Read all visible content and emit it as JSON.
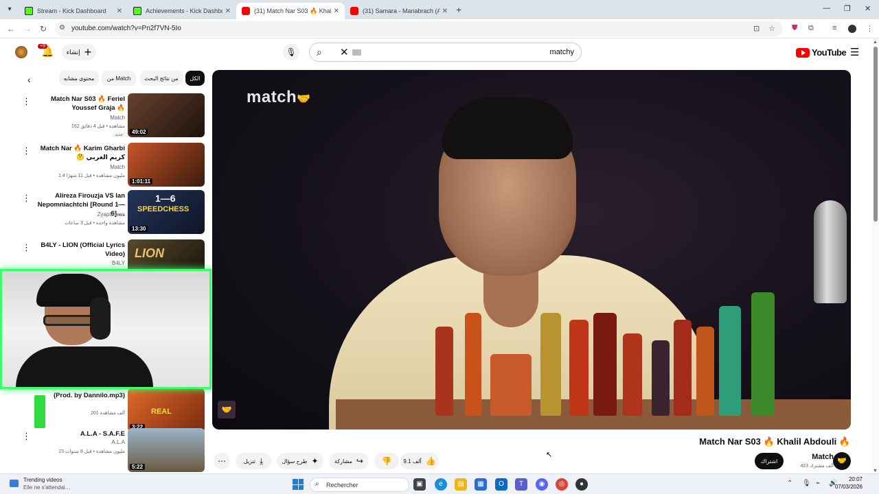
{
  "browser": {
    "tabs": [
      {
        "title": "Stream - Kick Dashboard",
        "type": "kick"
      },
      {
        "title": "Achievements - Kick Dashboard",
        "type": "kick"
      },
      {
        "title": "(31) Match Nar S03 🔥 Khalil A",
        "type": "yt"
      },
      {
        "title": "(31) Samara - Manabrach (Aud",
        "type": "yt"
      }
    ],
    "url": "youtube.com/watch?v=Pn2f7VN-5Io"
  },
  "masthead": {
    "notification_count": "+9",
    "create_label": "إنشاء",
    "search_query": "matchy",
    "logo_text": "YouTube"
  },
  "chips": [
    "الكل",
    "من نتائج البحث",
    "من Match",
    "محتوى مشابه"
  ],
  "related": [
    {
      "title": "Match Nar S03 🔥 Feriel Youssef Graja 🔥",
      "channel": "Match",
      "meta": "162 مشاهدة • قبل 4 دقائق",
      "badge": "جديد",
      "duration": "49:02",
      "thumb_color": "#3a2418"
    },
    {
      "title": "Match Nar 🔥 Karim Gharbi 🤔 كريم الغربي",
      "channel": "Match",
      "meta": "1.4 مليون مشاهدة • قبل 11 شهرًا",
      "badge": "",
      "duration": "1:01:11",
      "thumb_color": "#5a2c14"
    },
    {
      "title": "Alireza Firouzja VS Ian Nepomniachtchi [Round 1—6] …",
      "channel": "ZyapChess",
      "meta": "مشاهدة واحدة • قبل 3 ساعات",
      "badge": "",
      "duration": "13:30",
      "thumb_color": "#1d2a44",
      "thumb_text": "1—6",
      "thumb_sub": "SPEEDCHESS"
    },
    {
      "title": "B4LY - LION (Official Lyrics Video)",
      "channel": "B4LY",
      "meta": "",
      "badge": "",
      "duration": "",
      "thumb_color": "#2a2216",
      "thumb_text": "LION"
    },
    {
      "title": "(Prod. by Dannilo.mp3)",
      "channel": "",
      "meta": "201 ألف مشاهدة",
      "badge": "",
      "duration": "3:22",
      "thumb_color": "#c0501e",
      "thumb_text": "REAL"
    },
    {
      "title": "A.L.A - S.A.F.E",
      "channel": "A.L.A",
      "meta": "23 مليون مشاهدة • قبل 8 سنوات",
      "badge": "",
      "duration": "5:22",
      "thumb_color": "#6c8aa4"
    }
  ],
  "video": {
    "watermark": "match",
    "title": "Match Nar S03 🔥 Khalil Abdouli 🔥",
    "channel": "Match",
    "subscribers": "423 ألف مشترك",
    "subscribe_label": "اشتراك",
    "likes": "9.1 ألف",
    "share_label": "مشاركة",
    "ask_label": "طرح سؤال",
    "download_label": "تنزيل"
  },
  "taskbar": {
    "news_title": "Trending videos",
    "news_sub": "Elle ne s'attendai…",
    "search_placeholder": "Rechercher",
    "time": "20:07",
    "date": "07/03/2026"
  },
  "colors": {
    "webcam_border": "#39ff6a",
    "yt_red": "#ff0000",
    "kick_green": "#53fc18"
  }
}
